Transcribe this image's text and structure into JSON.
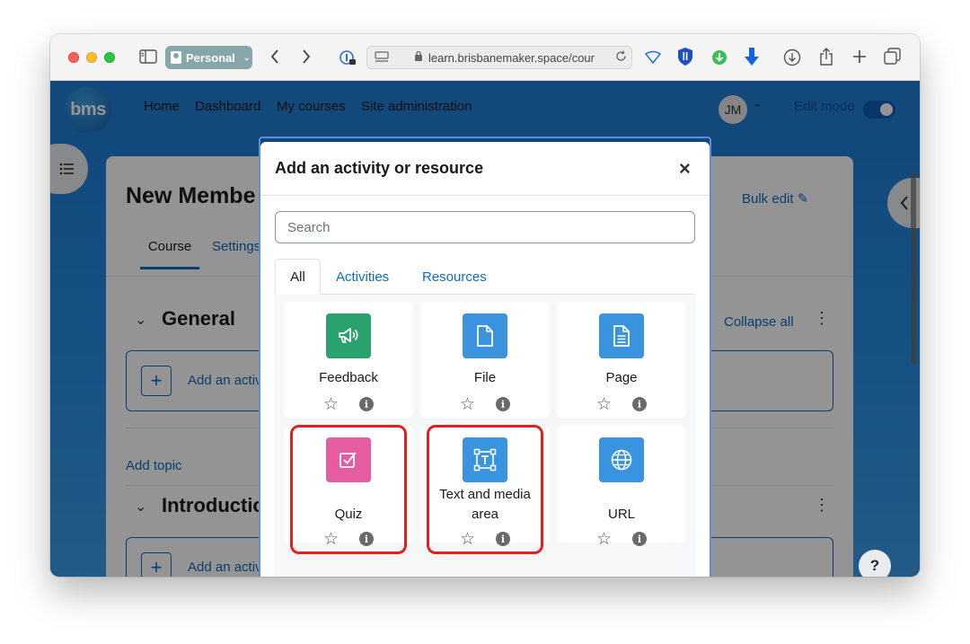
{
  "browser": {
    "profile_label": "Personal",
    "url": "learn.brisbanemaker.space/cour"
  },
  "site": {
    "logo_text": "bms",
    "nav": [
      "Home",
      "Dashboard",
      "My courses",
      "Site administration"
    ],
    "user_initials": "JM",
    "edit_mode_label": "Edit mode"
  },
  "course": {
    "title": "New Membe",
    "bulk_edit": "Bulk edit",
    "tabs": [
      "Course",
      "Settings"
    ],
    "sections": [
      {
        "title": "General",
        "add_label": "Add an activ"
      },
      {
        "title": "Introductio",
        "add_label": "Add an activ"
      }
    ],
    "collapse_all": "Collapse all",
    "add_topic": "Add topic"
  },
  "modal": {
    "title": "Add an activity or resource",
    "search_placeholder": "Search",
    "tabs": [
      "All",
      "Activities",
      "Resources"
    ],
    "tiles": [
      {
        "name": "Feedback",
        "icon": "megaphone-icon",
        "color": "#2aa26e",
        "highlighted": false
      },
      {
        "name": "File",
        "icon": "file-icon",
        "color": "#3a93de",
        "highlighted": false
      },
      {
        "name": "Page",
        "icon": "page-icon",
        "color": "#3a93de",
        "highlighted": false
      },
      {
        "name": "Quiz",
        "icon": "quiz-checkbox-icon",
        "color": "#e55d9f",
        "highlighted": true
      },
      {
        "name": "Text and media area",
        "icon": "text-area-icon",
        "color": "#3a93de",
        "highlighted": true
      },
      {
        "name": "URL",
        "icon": "globe-icon",
        "color": "#3a93de",
        "highlighted": false
      }
    ]
  },
  "colors": {
    "link": "#0f6cbf",
    "highlight": "#e0221c"
  }
}
